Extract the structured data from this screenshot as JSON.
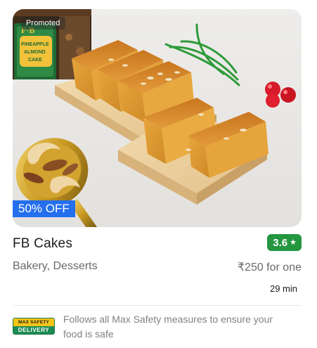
{
  "restaurant": {
    "promoted_label": "Promoted",
    "offer": "50% OFF",
    "name": "FB Cakes",
    "rating": "3.6",
    "cuisines": "Bakery, Desserts",
    "price": "₹250 for one",
    "delivery_time": "29 min",
    "image_icon": "cake-photo",
    "package_text": [
      "F·B",
      "PINEAPPLE",
      "ALMOND",
      "CAKE"
    ]
  },
  "safety": {
    "badge_top": "MAX SAFETY",
    "badge_bottom": "DELIVERY",
    "text": "Follows all Max Safety measures to ensure your food is safe"
  },
  "colors": {
    "offer_bg": "#256fef",
    "rating_bg": "#24963f",
    "badge_green": "#1d8a55",
    "badge_yellow": "#f5c518"
  }
}
